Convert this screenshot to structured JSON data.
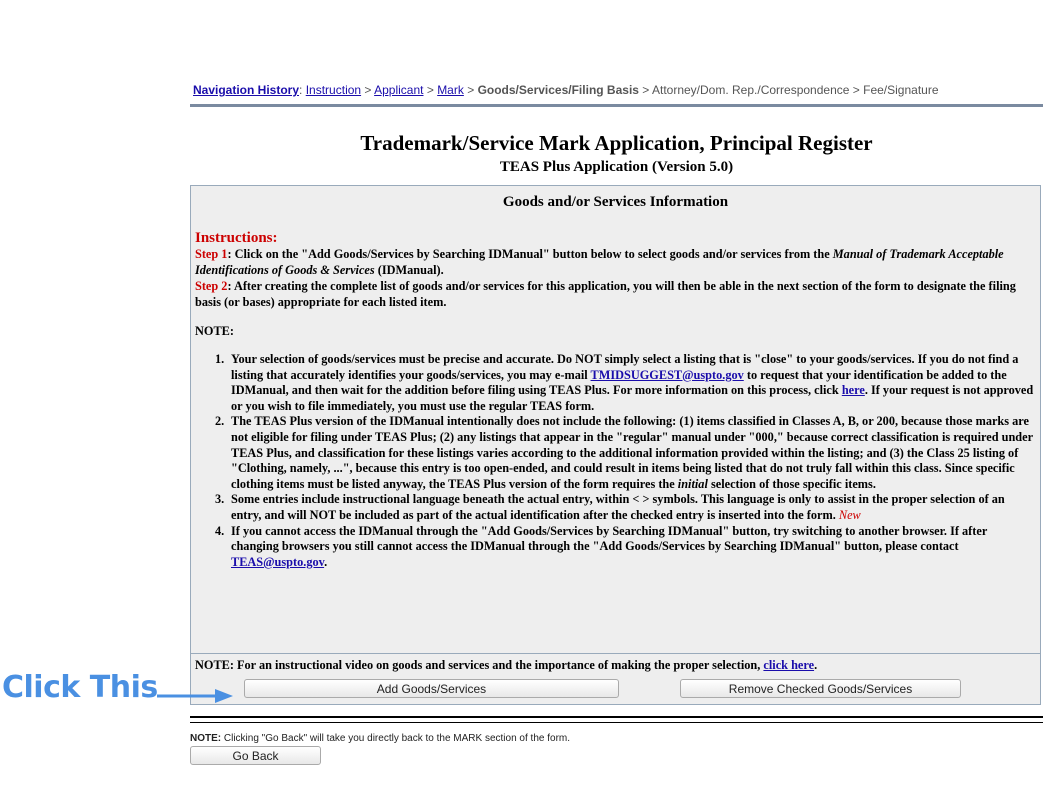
{
  "breadcrumb": {
    "label": "Navigation History",
    "sep_colon": ":",
    "items": [
      {
        "text": "Instruction",
        "link": true
      },
      {
        "text": "Applicant",
        "link": true
      },
      {
        "text": "Mark",
        "link": true
      },
      {
        "text": "Goods/Services/Filing Basis",
        "link": false,
        "current": true
      },
      {
        "text": "Attorney/Dom. Rep./Correspondence",
        "link": false
      },
      {
        "text": "Fee/Signature",
        "link": false
      }
    ],
    "separator": ">"
  },
  "header": {
    "title": "Trademark/Service Mark Application, Principal Register",
    "subtitle": "TEAS Plus Application (Version 5.0)"
  },
  "panel": {
    "heading": "Goods and/or Services Information",
    "instructions_title": "Instructions:",
    "step1_label": "Step 1",
    "step1_text_a": ": Click on the \"Add Goods/Services by Searching IDManual\" button below to select goods and/or services from the ",
    "step1_italic": "Manual of Trademark Acceptable Identifications of Goods & Services",
    "step1_text_b": " (IDManual).",
    "step2_label": "Step 2",
    "step2_text": ": After creating the complete list of goods and/or services for this application, you will then be able in the next section of the form to designate the filing basis (or bases) appropriate for each listed item.",
    "note_head": "NOTE:",
    "notes": {
      "n1_a": "Your selection of goods/services must be precise and accurate. Do NOT simply select a listing that is \"close\" to your goods/services. If you do not find a listing that accurately identifies your goods/services, you may e-mail ",
      "n1_email": "TMIDSUGGEST@uspto.gov",
      "n1_b": " to request that your identification be added to the IDManual, and then wait for the addition before filing using TEAS Plus. For more information on this process, click ",
      "n1_link": "here",
      "n1_c": ". If your request is not approved or you wish to file immediately, you must use the regular TEAS form.",
      "n2_a": "The TEAS Plus version of the IDManual intentionally does not include the following: (1) items classified in Classes A, B, or 200, because those marks are not eligible for filing under TEAS Plus; (2) any listings that appear in the \"regular\" manual under \"000,\" because correct classification is required under TEAS Plus, and classification for these listings varies according to the additional information provided within the listing; and (3) the Class 25 listing of \"Clothing, namely, ...\", because this entry is too open-ended, and could result in items being listed that do not truly fall within this class. Since specific clothing items must be listed anyway, the TEAS Plus version of the form requires the ",
      "n2_italic": "initial",
      "n2_b": " selection of those specific items.",
      "n3": "Some entries include instructional language beneath the actual entry, within < > symbols. This language is only to assist in the proper selection of an entry, and will NOT be included as part of the actual identification after the checked entry is inserted into the form.",
      "n3_new": "New",
      "n4_a": "If you cannot access the IDManual through the \"Add Goods/Services by Searching IDManual\" button, try switching to another browser. If after changing browsers you still cannot access the IDManual through the \"Add Goods/Services by Searching IDManual\" button, please contact ",
      "n4_email": "TEAS@uspto.gov",
      "n4_b": "."
    },
    "numbers": [
      "1.",
      "2.",
      "3.",
      "4."
    ],
    "video_note_a": "NOTE: For an instructional video on goods and services and the importance of making the proper selection, ",
    "video_note_link": "click here",
    "video_note_b": "."
  },
  "buttons": {
    "add": "Add Goods/Services",
    "remove": "Remove Checked Goods/Services",
    "go_back": "Go Back"
  },
  "annotation": {
    "text": "Click This",
    "color": "#4a90e2"
  },
  "footer": {
    "note_bold": "NOTE:",
    "note_text": " Clicking \"Go Back\" will take you directly back to the MARK section of the form."
  }
}
